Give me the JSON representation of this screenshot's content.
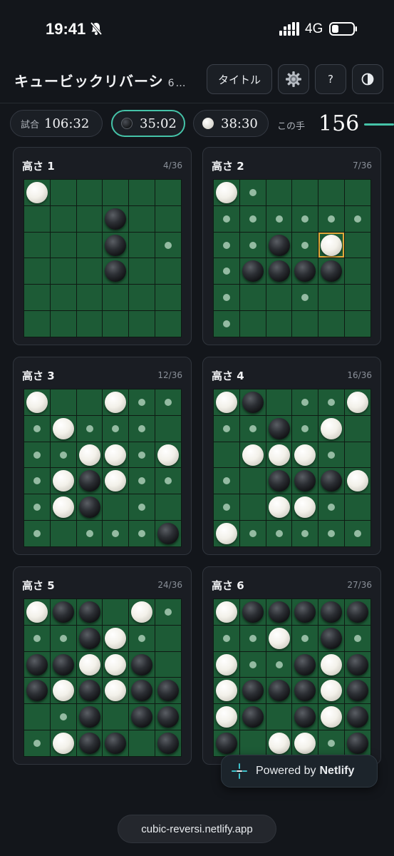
{
  "status_bar": {
    "time": "19:41",
    "network": "4G"
  },
  "header": {
    "title": "キュービックリバーシ",
    "subtitle": "6…",
    "buttons": {
      "title_label": "タイトル",
      "help_label": "?"
    }
  },
  "clocks": {
    "game_label": "試合",
    "game_time": "106:32",
    "black_time": "35:02",
    "white_time": "38:30",
    "active_player": "black",
    "move_label": "この手",
    "move_number": "156"
  },
  "colors": {
    "accent": "#45c3a8",
    "board": "#1d5b36",
    "highlight": "#e0a93a"
  },
  "board_legend": {
    "B": "black stone",
    "W": "white stone",
    "*": "legal move marker",
    ".": "empty"
  },
  "boards": [
    {
      "label": "高さ 1",
      "count": "4/36",
      "rows": [
        "W.....",
        "...B..",
        "...B.*",
        "...B..",
        "......",
        "......"
      ]
    },
    {
      "label": "高さ 2",
      "count": "7/36",
      "rows": [
        "W*....",
        "******",
        "**B*W.",
        "*BBBB.",
        "*..*..",
        "*....."
      ],
      "highlight": [
        2,
        4
      ]
    },
    {
      "label": "高さ 3",
      "count": "12/36",
      "rows": [
        "W..W**",
        "*W***.",
        "**WW*W",
        "*WBW**",
        "*WB.*.",
        "*.***B"
      ]
    },
    {
      "label": "高さ 4",
      "count": "16/36",
      "rows": [
        "WB.**W",
        "**B*W.",
        ".WWW*.",
        "*.BBBW",
        "*.WW*.",
        "W*****"
      ]
    },
    {
      "label": "高さ 5",
      "count": "24/36",
      "rows": [
        "WBB.W*",
        "**BW*.",
        "BBWWB.",
        "BWBWBB",
        ".*B.BB",
        "*WBB.B"
      ]
    },
    {
      "label": "高さ 6",
      "count": "27/36",
      "rows": [
        "WBBBBB",
        "**W*B*",
        "W**BWB",
        "WBBBWB",
        "WB.BWB",
        "B.WW*B"
      ]
    }
  ],
  "netlify": {
    "prefix": "Powered by",
    "brand": "Netlify"
  },
  "url": "cubic-reversi.netlify.app"
}
